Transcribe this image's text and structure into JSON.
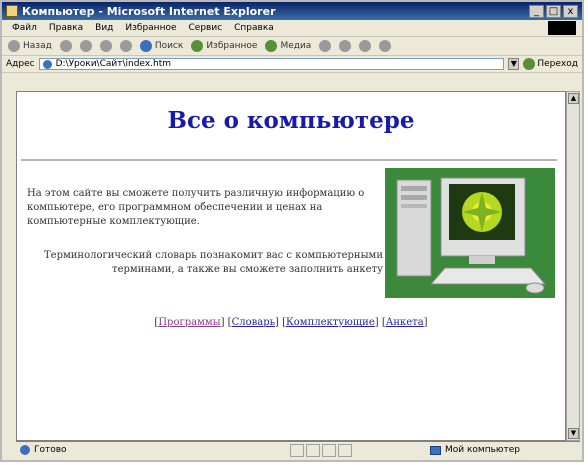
{
  "window": {
    "title": "Компьютер - Microsoft Internet Explorer",
    "buttons": {
      "minimize": "_",
      "maximize": "□",
      "close": "x"
    }
  },
  "menu": [
    "Файл",
    "Правка",
    "Вид",
    "Избранное",
    "Сервис",
    "Справка"
  ],
  "toolbar": {
    "back": "Назад",
    "search": "Поиск",
    "favorites": "Избранное",
    "media": "Медиа"
  },
  "address": {
    "label": "Адрес",
    "value": "D:\\Уроки\\Сайт\\index.htm",
    "go": "Переход"
  },
  "page": {
    "heading": "Все о компьютере",
    "paragraph1": "На этом сайте вы сможете получить различную информацию о компьютере, его программном обеспечении и ценах на компьютерные комплектующие.",
    "paragraph2": "Терминологический словарь познакомит вас с компьютерными терминами, а также вы сможете заполнить анкету",
    "links": [
      "Программы",
      "Словарь",
      "Комплектующие",
      "Анкета"
    ]
  },
  "status": {
    "left": "Готово",
    "right": "Мой компьютер"
  },
  "colors": {
    "heading": "#1a1aa8",
    "link": "#2424a0",
    "visited_link": "#8a3b8a"
  }
}
